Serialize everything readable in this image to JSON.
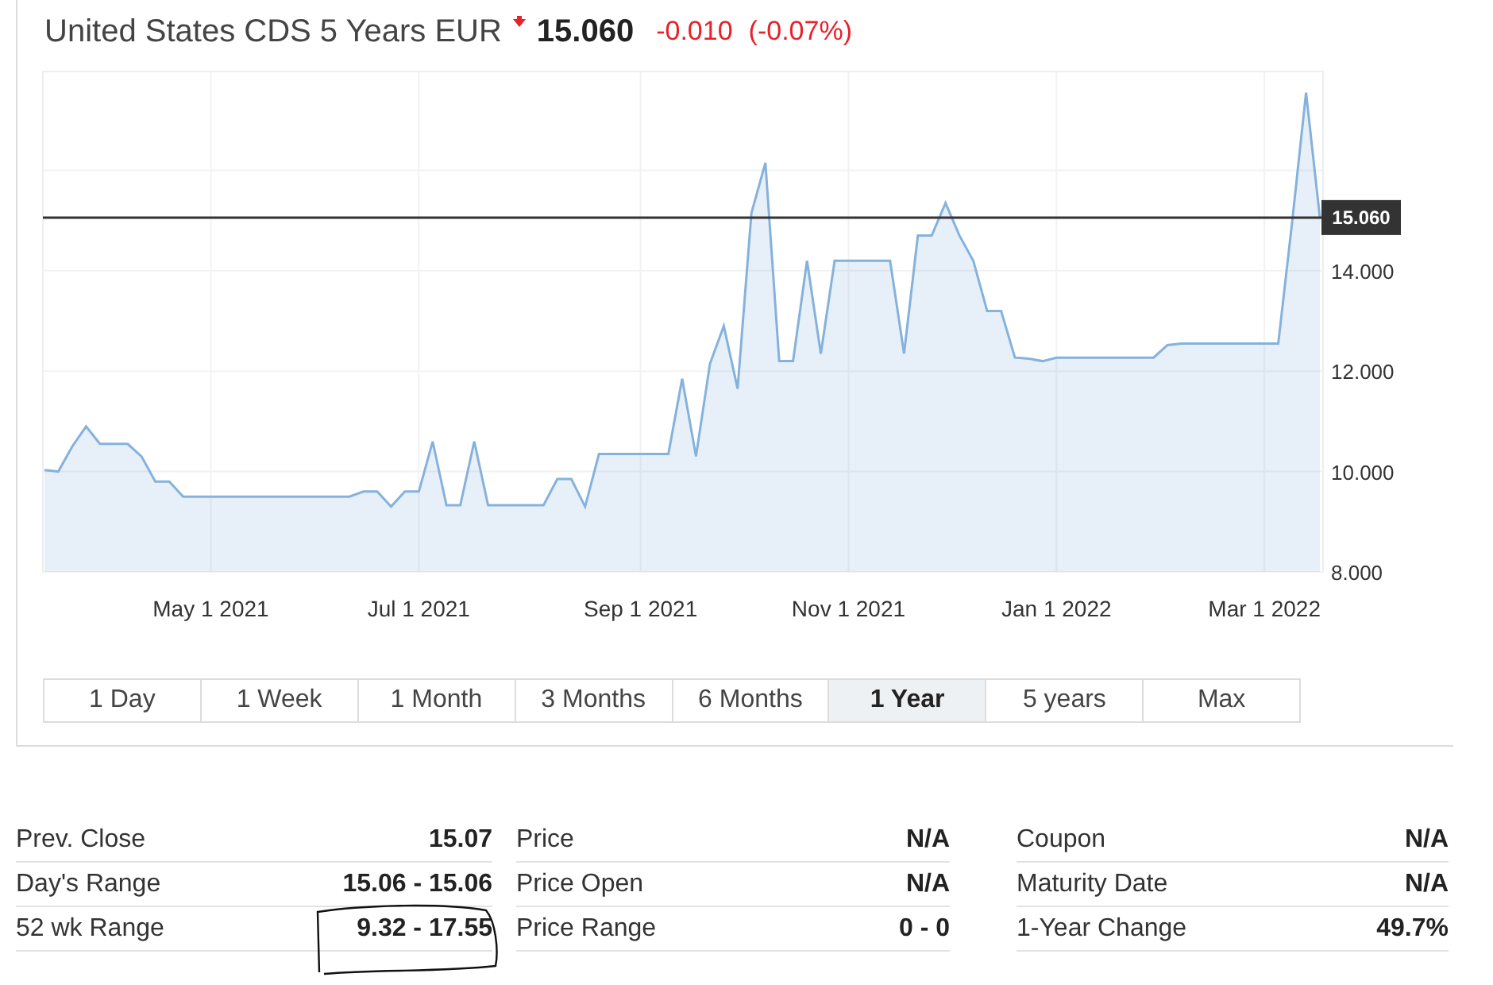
{
  "header": {
    "title": "United States CDS 5 Years EUR",
    "falling": true,
    "price": "15.060",
    "change": "-0.010",
    "change_percent": "(-0.07%)"
  },
  "chart": {
    "chart_data": {
      "type": "area",
      "categories": [
        null,
        null,
        null,
        null,
        null,
        null,
        null,
        null,
        null,
        null,
        null,
        null,
        "May 1 2021",
        null,
        null,
        null,
        null,
        null,
        null,
        null,
        null,
        null,
        null,
        null,
        null,
        null,
        null,
        "Jul 1 2021",
        null,
        null,
        null,
        null,
        null,
        null,
        null,
        null,
        null,
        null,
        null,
        null,
        null,
        null,
        null,
        "Sep 1 2021",
        null,
        null,
        null,
        null,
        null,
        null,
        null,
        null,
        null,
        null,
        null,
        null,
        null,
        null,
        "Nov 1 2021",
        null,
        null,
        null,
        null,
        null,
        null,
        null,
        null,
        null,
        null,
        null,
        null,
        null,
        null,
        "Jan 1 2022",
        null,
        null,
        null,
        null,
        null,
        null,
        null,
        null,
        null,
        null,
        null,
        null,
        null,
        null,
        "Mar 1 2022",
        null,
        null,
        null,
        null
      ],
      "series": [
        {
          "color": "#85b2dc",
          "values": [
            10.03,
            10.0,
            10.5,
            10.9,
            10.55,
            10.55,
            10.55,
            10.3,
            9.8,
            9.8,
            9.5,
            9.5,
            9.5,
            9.5,
            9.5,
            9.5,
            9.5,
            9.5,
            9.5,
            9.5,
            9.5,
            9.5,
            9.5,
            9.6,
            9.6,
            9.3,
            9.6,
            9.6,
            10.6,
            9.33,
            9.33,
            10.6,
            9.33,
            9.33,
            9.33,
            9.33,
            9.33,
            9.85,
            9.85,
            9.3,
            10.35,
            10.35,
            10.35,
            10.35,
            10.35,
            10.35,
            11.85,
            10.3,
            12.15,
            12.9,
            11.65,
            15.15,
            16.15,
            12.2,
            12.2,
            14.2,
            12.35,
            14.2,
            14.2,
            14.2,
            14.2,
            14.2,
            12.35,
            14.7,
            14.7,
            15.35,
            14.7,
            14.2,
            13.2,
            13.2,
            12.27,
            12.25,
            12.2,
            12.27,
            12.27,
            12.27,
            12.27,
            12.27,
            12.27,
            12.27,
            12.27,
            12.52,
            12.55,
            12.55,
            12.55,
            12.55,
            12.55,
            12.55,
            12.55,
            12.55,
            14.96,
            17.55,
            15.06
          ]
        }
      ],
      "ylim": [
        8,
        17.97
      ],
      "yticks": [
        {
          "value": 8,
          "label": "8.000"
        },
        {
          "value": 10,
          "label": "10.000"
        },
        {
          "value": 12,
          "label": "12.000"
        },
        {
          "value": 14,
          "label": "14.000"
        }
      ],
      "grid": true,
      "ref_lines": [
        {
          "axis": "y",
          "value": 15.06,
          "label": "15.060",
          "color": "#333333"
        }
      ]
    }
  },
  "range_tabs": [
    {
      "label": "1 Day",
      "selected": false
    },
    {
      "label": "1 Week",
      "selected": false
    },
    {
      "label": "1 Month",
      "selected": false
    },
    {
      "label": "3 Months",
      "selected": false
    },
    {
      "label": "6 Months",
      "selected": false
    },
    {
      "label": "1 Year",
      "selected": true
    },
    {
      "label": "5 years",
      "selected": false
    },
    {
      "label": "Max",
      "selected": false
    }
  ],
  "stats_columns": [
    {
      "rows": [
        {
          "label": "Prev. Close",
          "value": "15.07",
          "circled": false
        },
        {
          "label": "Day's Range",
          "value": "15.06 - 15.06",
          "circled": false
        },
        {
          "label": "52 wk Range",
          "value": "9.32 - 17.55",
          "circled": true
        }
      ]
    },
    {
      "rows": [
        {
          "label": "Price",
          "value": "N/A",
          "circled": false
        },
        {
          "label": "Price Open",
          "value": "N/A",
          "circled": false
        },
        {
          "label": "Price Range",
          "value": "0 - 0",
          "circled": false
        }
      ]
    },
    {
      "rows": [
        {
          "label": "Coupon",
          "value": "N/A",
          "circled": false
        },
        {
          "label": "Maturity Date",
          "value": "N/A",
          "circled": false
        },
        {
          "label": "1-Year Change",
          "value": "49.7%",
          "circled": false
        }
      ]
    }
  ]
}
